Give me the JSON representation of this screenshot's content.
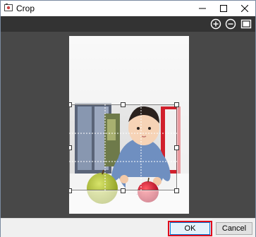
{
  "window": {
    "title": "Crop"
  },
  "toolbar": {
    "buttons": [
      {
        "icon": "zoom-in-icon"
      },
      {
        "icon": "zoom-out-icon"
      },
      {
        "icon": "fit-to-window-icon"
      }
    ]
  },
  "footer": {
    "ok_label": "OK",
    "cancel_label": "Cancel"
  },
  "colors": {
    "toolbar_bg": "#333333",
    "canvas_bg": "#484848",
    "highlight": "#e0001b"
  }
}
